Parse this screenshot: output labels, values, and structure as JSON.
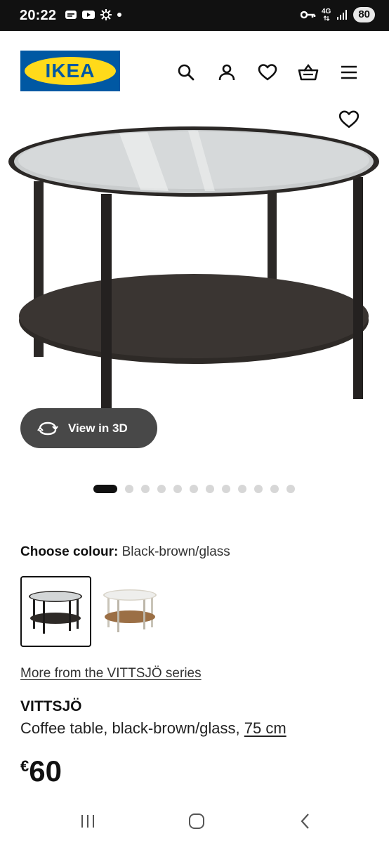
{
  "status_bar": {
    "time": "20:22",
    "network_label": "4G",
    "battery": "80"
  },
  "header": {
    "logo_text": "IKEA",
    "icons": [
      "search-icon",
      "user-icon",
      "heart-icon",
      "basket-icon",
      "menu-icon"
    ]
  },
  "gallery": {
    "view_3d_label": "View in 3D",
    "dot_count": 12,
    "active_dot": 0
  },
  "colour": {
    "label": "Choose colour:",
    "value": "Black-brown/glass"
  },
  "product": {
    "series_link": "More from the VITTSJÖ series",
    "name": "VITTSJÖ",
    "description": "Coffee table, black-brown/glass,",
    "size": "75 cm",
    "price_currency": "€",
    "price_amount": "60"
  },
  "colors": {
    "ikea_blue": "#0058a3",
    "ikea_yellow": "#ffda1a",
    "view3d_bg": "#484848"
  }
}
